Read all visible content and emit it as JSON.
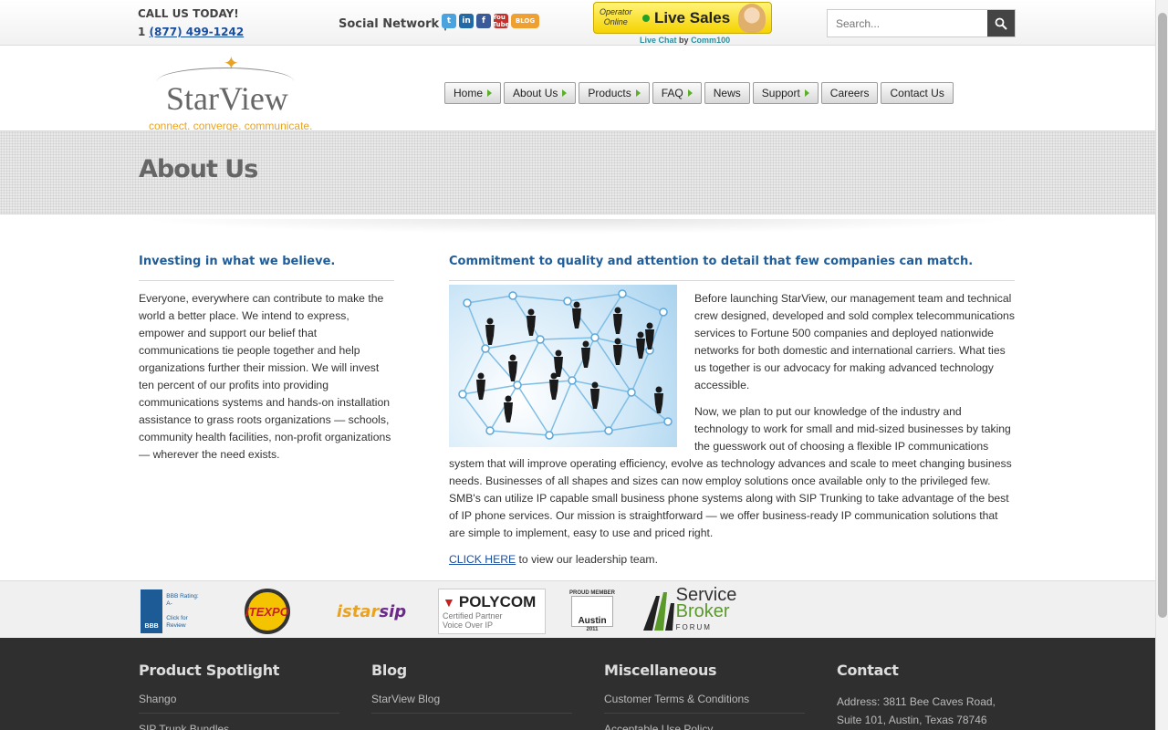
{
  "topbar": {
    "call_label": "CALL US TODAY!",
    "phone_prefix": "1",
    "phone_number": "(877) 499-1242",
    "social_label": "Social Network  |",
    "social": [
      "twitter-icon",
      "linkedin-icon",
      "facebook-icon",
      "youtube-icon",
      "blog-icon"
    ],
    "youtube_text": "You Tube",
    "blog_text": "BLOG",
    "livechat": {
      "operator_line1": "Operator",
      "operator_line2": "Online",
      "button_label": "Live Sales",
      "credit_prefix": "Live Chat",
      "credit_by": "by",
      "credit_vendor": "Comm100"
    },
    "search": {
      "placeholder": "Search..."
    }
  },
  "header": {
    "logo_name": "StarView",
    "tagline": "connect. converge. communicate.",
    "nav": [
      {
        "label": "Home",
        "arrow": true
      },
      {
        "label": "About Us",
        "arrow": true
      },
      {
        "label": "Products",
        "arrow": true
      },
      {
        "label": "FAQ",
        "arrow": true
      },
      {
        "label": "News",
        "arrow": false
      },
      {
        "label": "Support",
        "arrow": true
      },
      {
        "label": "Careers",
        "arrow": false
      },
      {
        "label": "Contact Us",
        "arrow": false
      }
    ]
  },
  "page": {
    "title": "About Us"
  },
  "left": {
    "heading": "Investing in what we believe.",
    "body": "Everyone, everywhere can contribute to make the world a better place. We intend to express, empower and support our belief that communications tie people together and help organizations further their mission. We will invest ten percent of our profits into providing communications systems and hands-on installation assistance to grass roots organizations — schools, community health facilities, non-profit organizations — wherever the need exists."
  },
  "right": {
    "heading": "Commitment to quality and attention to detail that few companies can match.",
    "para1": "Before launching StarView, our management team and technical crew designed, developed and sold complex telecommunications services to Fortune 500 companies and deployed nationwide networks for both domestic and international carriers. What ties us together is our advocacy for making advanced technology accessible.",
    "para2": "Now, we plan to put our knowledge of the industry and technology to work for small and mid-sized businesses by taking the guesswork out of choosing a flexible IP communications system that will improve operating efficiency, evolve as technology advances and scale to meet changing business needs. Businesses of all shapes and sizes can now employ solutions once available only to the privileged few. SMB's can utilize IP capable small business phone systems along with SIP Trunking to take advantage of the best of IP phone services. Our mission is straightforward — we offer business-ready IP communication solutions that are simple to implement, easy to use and priced right.",
    "link_text": "CLICK HERE",
    "link_suffix": " to view our leadership team."
  },
  "partners": {
    "bbb_seal": "BBB",
    "bbb_rating": "BBB Rating: A-",
    "bbb_click": "Click for Review",
    "itexpo": "ITEXPO",
    "istar_a": "istar",
    "istar_b": "sip",
    "polycom_name": "POLYCOM",
    "polycom_sub1": "Certified Partner",
    "polycom_sub2": "Voice Over IP",
    "austin_top": "PROUD MEMBER",
    "austin_name": "Austin",
    "austin_year": "2011",
    "sbf_line1": "Service",
    "sbf_line2": "Broker",
    "sbf_line3": "FORUM"
  },
  "footer": {
    "cols": [
      {
        "title": "Product Spotlight",
        "items": [
          "Shango",
          "SIP Trunk Bundles"
        ]
      },
      {
        "title": "Blog",
        "items": [
          "StarView Blog"
        ]
      },
      {
        "title": "Miscellaneous",
        "items": [
          "Customer Terms & Conditions",
          "Acceptable Use Policy"
        ]
      },
      {
        "title": "Contact",
        "address": [
          "Address: 3811 Bee Caves Road,",
          "Suite 101, Austin, Texas 78746"
        ]
      }
    ]
  },
  "colors": {
    "accent_blue": "#1e5d9a",
    "brand_gold": "#e8a323",
    "nav_arrow": "#5cae2b",
    "footer_bg": "#2f2f2f"
  }
}
